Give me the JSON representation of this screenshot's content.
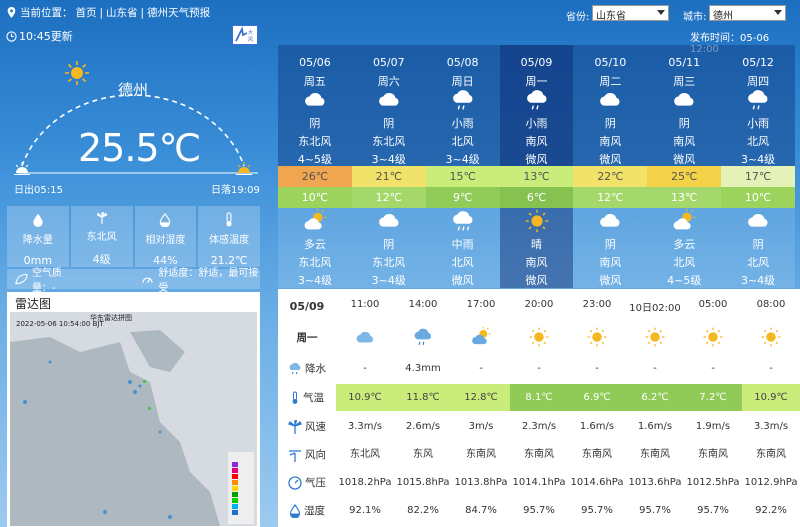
{
  "breadcrumb": {
    "prefix": "当前位置：",
    "home": "首页",
    "sep": "|",
    "province": "山东省",
    "page": "德州天气预报"
  },
  "selectors": {
    "province_label": "省份:",
    "province_value": "山东省",
    "city_label": "城市:",
    "city_value": "德州"
  },
  "update_time": "10:45更新",
  "publish_time": "发布时间：05-06 12:00",
  "current": {
    "city": "德州",
    "temp": "25.5℃",
    "sunrise": "日出05:15",
    "sunset": "日落19:09"
  },
  "stats": [
    {
      "label": "降水量",
      "value": "0mm",
      "icon": "raindrop-icon"
    },
    {
      "label": "东北风",
      "value": "4级",
      "icon": "windmill-icon"
    },
    {
      "label": "相对湿度",
      "value": "44%",
      "icon": "humidity-drop-icon"
    },
    {
      "label": "体感温度",
      "value": "21.2℃",
      "icon": "thermometer-icon"
    }
  ],
  "air_quality": {
    "label": "空气质量：-",
    "comfort": "舒适度：舒适，最可接受"
  },
  "radar": {
    "title": "雷达图",
    "map_title": "华东雷达拼图",
    "map_time": "2022-05-06 10:54:00 BJT"
  },
  "forecast": [
    {
      "date": "05/06",
      "weekday": "周五",
      "day_icon": "overcast",
      "day_weather": "阴",
      "day_wind_dir": "东北风",
      "day_wind": "4~5级",
      "high": "26℃",
      "low": "10℃",
      "night_icon": "partly-cloudy",
      "night_weather": "多云",
      "night_wind_dir": "东北风",
      "night_wind": "3~4级",
      "high_color": "#f0a64e",
      "low_color": "#9bd35c"
    },
    {
      "date": "05/07",
      "weekday": "周六",
      "day_icon": "overcast",
      "day_weather": "阴",
      "day_wind_dir": "东北风",
      "day_wind": "3~4级",
      "high": "21℃",
      "low": "12℃",
      "night_icon": "overcast",
      "night_weather": "阴",
      "night_wind_dir": "东北风",
      "night_wind": "3~4级",
      "high_color": "#f1e26a",
      "low_color": "#a4d86a"
    },
    {
      "date": "05/08",
      "weekday": "周日",
      "day_icon": "light-rain",
      "day_weather": "小雨",
      "day_wind_dir": "北风",
      "day_wind": "3~4级",
      "high": "15℃",
      "low": "9℃",
      "night_icon": "moderate-rain",
      "night_weather": "中雨",
      "night_wind_dir": "北风",
      "night_wind": "微风",
      "high_color": "#c9ec7a",
      "low_color": "#92cc58"
    },
    {
      "date": "05/09",
      "weekday": "周一",
      "day_icon": "light-rain",
      "day_weather": "小雨",
      "day_wind_dir": "南风",
      "day_wind": "微风",
      "high": "13℃",
      "low": "6℃",
      "night_icon": "sunny",
      "night_weather": "晴",
      "night_wind_dir": "南风",
      "night_wind": "微风",
      "high_color": "#c9ec7a",
      "low_color": "#85c250"
    },
    {
      "date": "05/10",
      "weekday": "周二",
      "day_icon": "overcast",
      "day_weather": "阴",
      "day_wind_dir": "南风",
      "day_wind": "微风",
      "high": "22℃",
      "low": "12℃",
      "night_icon": "overcast",
      "night_weather": "阴",
      "night_wind_dir": "南风",
      "night_wind": "微风",
      "high_color": "#f1e26a",
      "low_color": "#a4d86a"
    },
    {
      "date": "05/11",
      "weekday": "周三",
      "day_icon": "overcast",
      "day_weather": "阴",
      "day_wind_dir": "南风",
      "day_wind": "微风",
      "high": "25℃",
      "low": "13℃",
      "night_icon": "partly-cloudy",
      "night_weather": "多云",
      "night_wind_dir": "北风",
      "night_wind": "4~5级",
      "high_color": "#f4d24a",
      "low_color": "#a4d86a"
    },
    {
      "date": "05/12",
      "weekday": "周四",
      "day_icon": "light-rain",
      "day_weather": "小雨",
      "day_wind_dir": "北风",
      "day_wind": "3~4级",
      "high": "17℃",
      "low": "10℃",
      "night_icon": "overcast",
      "night_weather": "阴",
      "night_wind_dir": "北风",
      "night_wind": "3~4级",
      "high_color": "#e4f2b8",
      "low_color": "#9bd35c"
    }
  ],
  "hourly": {
    "date": "05/09",
    "weekday": "周一",
    "times": [
      "11:00",
      "14:00",
      "17:00",
      "20:00",
      "23:00",
      "10日02:00",
      "05:00",
      "08:00"
    ],
    "icons": [
      "cloudy-night",
      "light-rain",
      "partly-cloudy",
      "sunny",
      "sunny",
      "sunny",
      "sunny",
      "sunny"
    ],
    "precip": [
      "-",
      "4.3mm",
      "-",
      "-",
      "-",
      "-",
      "-",
      "-"
    ],
    "temp": [
      "10.9℃",
      "11.8℃",
      "12.8℃",
      "8.1℃",
      "6.9℃",
      "6.2℃",
      "7.2℃",
      "10.9℃"
    ],
    "temp_colors": [
      "#c9ec7a",
      "#c9ec7a",
      "#c9ec7a",
      "#8fcb56",
      "#8fcb56",
      "#8fcb56",
      "#8fcb56",
      "#c9ec7a"
    ],
    "wind_speed": [
      "3.3m/s",
      "2.6m/s",
      "3m/s",
      "2.3m/s",
      "1.6m/s",
      "1.6m/s",
      "1.9m/s",
      "3.3m/s"
    ],
    "wind_dir": [
      "东北风",
      "东风",
      "东南风",
      "东南风",
      "东南风",
      "东南风",
      "东南风",
      "东南风"
    ],
    "pressure": [
      "1018.2hPa",
      "1015.8hPa",
      "1013.8hPa",
      "1014.1hPa",
      "1014.6hPa",
      "1013.6hPa",
      "1012.5hPa",
      "1012.9hPa"
    ],
    "humidity": [
      "92.1%",
      "82.2%",
      "84.7%",
      "95.7%",
      "95.7%",
      "95.7%",
      "95.7%",
      "92.2%"
    ],
    "labels": {
      "precip": "降水",
      "temp": "气温",
      "wind_speed": "风速",
      "wind_dir": "风向",
      "pressure": "气压",
      "humidity": "湿度"
    }
  },
  "colors": {
    "selected_column": "#0a2a6e",
    "sun": "#f5b820",
    "cloud": "#ffffff"
  }
}
